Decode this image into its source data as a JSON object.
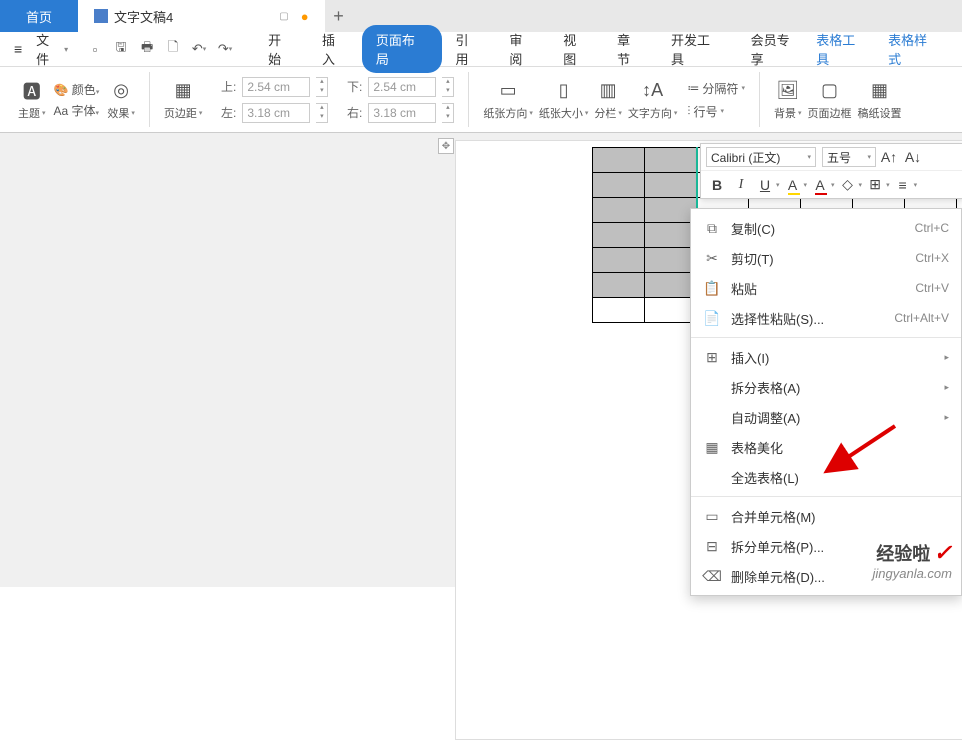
{
  "tabs": {
    "home": "首页",
    "doc": "文字文稿4"
  },
  "menu": {
    "file": "文件",
    "items": [
      "开始",
      "插入",
      "页面布局",
      "引用",
      "审阅",
      "视图",
      "章节",
      "开发工具",
      "会员专享"
    ],
    "active_index": 2,
    "right": {
      "tableTools": "表格工具",
      "tableStyle": "表格样式"
    }
  },
  "ribbon": {
    "theme": "主题",
    "color": "颜色",
    "font": "Aa 字体",
    "effect": "效果",
    "pageMargin": "页边距",
    "margins": {
      "topLbl": "上:",
      "topVal": "2.54 cm",
      "botLbl": "下:",
      "botVal": "2.54 cm",
      "leftLbl": "左:",
      "leftVal": "3.18 cm",
      "rightLbl": "右:",
      "rightVal": "3.18 cm"
    },
    "paperDir": "纸张方向",
    "paperSize": "纸张大小",
    "columns": "分栏",
    "textDir": "文字方向",
    "separator": "分隔符",
    "lineNum": "行号",
    "background": "背景",
    "pageBorder": "页面边框",
    "gridSetting": "稿纸设置"
  },
  "miniToolbar": {
    "font": "Calibri (正文)",
    "size": "五号"
  },
  "context": {
    "copy": {
      "label": "复制(C)",
      "shortcut": "Ctrl+C"
    },
    "cut": {
      "label": "剪切(T)",
      "shortcut": "Ctrl+X"
    },
    "paste": {
      "label": "粘贴",
      "shortcut": "Ctrl+V"
    },
    "pasteS": {
      "label": "选择性粘贴(S)...",
      "shortcut": "Ctrl+Alt+V"
    },
    "insert": {
      "label": "插入(I)"
    },
    "splitT": {
      "label": "拆分表格(A)"
    },
    "autoFit": {
      "label": "自动调整(A)"
    },
    "beautify": {
      "label": "表格美化"
    },
    "selectAll": {
      "label": "全选表格(L)"
    },
    "merge": {
      "label": "合并单元格(M)"
    },
    "splitC": {
      "label": "拆分单元格(P)..."
    },
    "delCell": {
      "label": "删除单元格(D)..."
    }
  },
  "watermark": {
    "brand": "经验啦",
    "url": "jingyanla.com"
  }
}
